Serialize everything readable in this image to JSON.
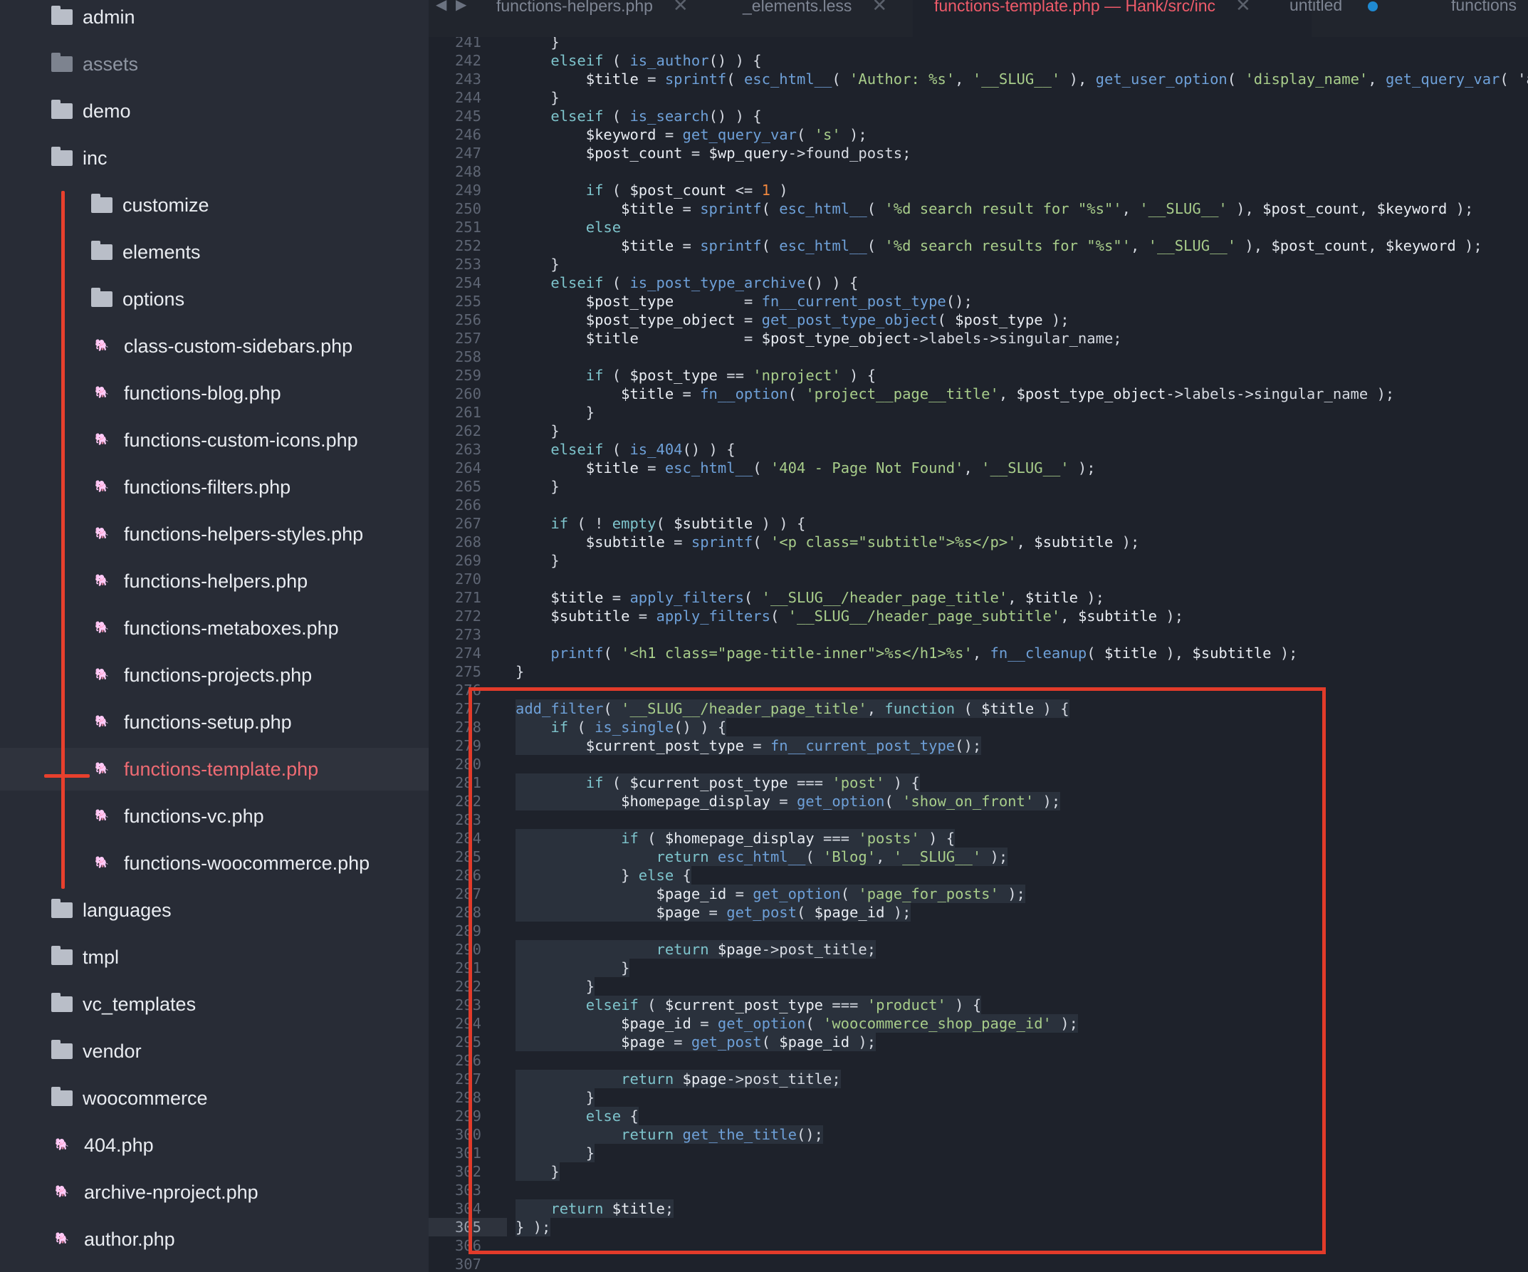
{
  "sidebar": {
    "items": [
      {
        "label": "admin",
        "type": "folder",
        "depth": 0
      },
      {
        "label": "assets",
        "type": "folder",
        "depth": 0,
        "muted": true
      },
      {
        "label": "demo",
        "type": "folder",
        "depth": 0
      },
      {
        "label": "inc",
        "type": "folder-open",
        "depth": 0
      },
      {
        "label": "customize",
        "type": "folder",
        "depth": 1
      },
      {
        "label": "elements",
        "type": "folder",
        "depth": 1
      },
      {
        "label": "options",
        "type": "folder",
        "depth": 1
      },
      {
        "label": "class-custom-sidebars.php",
        "type": "php",
        "depth": 1
      },
      {
        "label": "functions-blog.php",
        "type": "php",
        "depth": 1
      },
      {
        "label": "functions-custom-icons.php",
        "type": "php",
        "depth": 1
      },
      {
        "label": "functions-filters.php",
        "type": "php",
        "depth": 1
      },
      {
        "label": "functions-helpers-styles.php",
        "type": "php",
        "depth": 1
      },
      {
        "label": "functions-helpers.php",
        "type": "php",
        "depth": 1
      },
      {
        "label": "functions-metaboxes.php",
        "type": "php",
        "depth": 1
      },
      {
        "label": "functions-projects.php",
        "type": "php",
        "depth": 1
      },
      {
        "label": "functions-setup.php",
        "type": "php",
        "depth": 1
      },
      {
        "label": "functions-template.php",
        "type": "php",
        "depth": 1,
        "active": true
      },
      {
        "label": "functions-vc.php",
        "type": "php",
        "depth": 1
      },
      {
        "label": "functions-woocommerce.php",
        "type": "php",
        "depth": 1
      },
      {
        "label": "languages",
        "type": "folder",
        "depth": 0
      },
      {
        "label": "tmpl",
        "type": "folder",
        "depth": 0
      },
      {
        "label": "vc_templates",
        "type": "folder",
        "depth": 0
      },
      {
        "label": "vendor",
        "type": "folder",
        "depth": 0
      },
      {
        "label": "woocommerce",
        "type": "folder",
        "depth": 0
      },
      {
        "label": "404.php",
        "type": "php",
        "depth": 0
      },
      {
        "label": "archive-nproject.php",
        "type": "php",
        "depth": 0
      },
      {
        "label": "author.php",
        "type": "php",
        "depth": 0
      }
    ]
  },
  "tabs": [
    {
      "label": "functions-helpers.php",
      "close": "✕"
    },
    {
      "label": "_elements.less",
      "close": "✕"
    },
    {
      "label": "functions-template.php — Hank/src/inc",
      "close": "✕",
      "active": true
    },
    {
      "label": "untitled",
      "modified": true
    },
    {
      "label": "functions"
    }
  ],
  "editor": {
    "current_line": 305,
    "lines": [
      {
        "n": 241,
        "code": "    }"
      },
      {
        "n": 242,
        "code": "    elseif ( is_author() ) {"
      },
      {
        "n": 243,
        "code": "        $title = sprintf( esc_html__( 'Author: %s', '__SLUG__' ), get_user_option( 'display_name', get_query_var( 'auth"
      },
      {
        "n": 244,
        "code": "    }"
      },
      {
        "n": 245,
        "code": "    elseif ( is_search() ) {"
      },
      {
        "n": 246,
        "code": "        $keyword = get_query_var( 's' );"
      },
      {
        "n": 247,
        "code": "        $post_count = $wp_query->found_posts;"
      },
      {
        "n": 248,
        "code": ""
      },
      {
        "n": 249,
        "code": "        if ( $post_count <= 1 )"
      },
      {
        "n": 250,
        "code": "            $title = sprintf( esc_html__( '%d search result for \"%s\"', '__SLUG__' ), $post_count, $keyword );"
      },
      {
        "n": 251,
        "code": "        else"
      },
      {
        "n": 252,
        "code": "            $title = sprintf( esc_html__( '%d search results for \"%s\"', '__SLUG__' ), $post_count, $keyword );"
      },
      {
        "n": 253,
        "code": "    }"
      },
      {
        "n": 254,
        "code": "    elseif ( is_post_type_archive() ) {"
      },
      {
        "n": 255,
        "code": "        $post_type        = fn__current_post_type();"
      },
      {
        "n": 256,
        "code": "        $post_type_object = get_post_type_object( $post_type );"
      },
      {
        "n": 257,
        "code": "        $title            = $post_type_object->labels->singular_name;"
      },
      {
        "n": 258,
        "code": ""
      },
      {
        "n": 259,
        "code": "        if ( $post_type == 'nproject' ) {"
      },
      {
        "n": 260,
        "code": "            $title = fn__option( 'project__page__title', $post_type_object->labels->singular_name );"
      },
      {
        "n": 261,
        "code": "        }"
      },
      {
        "n": 262,
        "code": "    }"
      },
      {
        "n": 263,
        "code": "    elseif ( is_404() ) {"
      },
      {
        "n": 264,
        "code": "        $title = esc_html__( '404 - Page Not Found', '__SLUG__' );"
      },
      {
        "n": 265,
        "code": "    }"
      },
      {
        "n": 266,
        "code": ""
      },
      {
        "n": 267,
        "code": "    if ( ! empty( $subtitle ) ) {"
      },
      {
        "n": 268,
        "code": "        $subtitle = sprintf( '<p class=\"subtitle\">%s</p>', $subtitle );"
      },
      {
        "n": 269,
        "code": "    }"
      },
      {
        "n": 270,
        "code": ""
      },
      {
        "n": 271,
        "code": "    $title = apply_filters( '__SLUG__/header_page_title', $title );"
      },
      {
        "n": 272,
        "code": "    $subtitle = apply_filters( '__SLUG__/header_page_subtitle', $subtitle );"
      },
      {
        "n": 273,
        "code": ""
      },
      {
        "n": 274,
        "code": "    printf( '<h1 class=\"page-title-inner\">%s</h1>%s', fn__cleanup( $title ), $subtitle );"
      },
      {
        "n": 275,
        "code": "}"
      },
      {
        "n": 276,
        "code": ""
      },
      {
        "n": 277,
        "code": "add_filter( '__SLUG__/header_page_title', function ( $title ) {"
      },
      {
        "n": 278,
        "code": "    if ( is_single() ) {"
      },
      {
        "n": 279,
        "code": "        $current_post_type = fn__current_post_type();"
      },
      {
        "n": 280,
        "code": ""
      },
      {
        "n": 281,
        "code": "        if ( $current_post_type === 'post' ) {"
      },
      {
        "n": 282,
        "code": "            $homepage_display = get_option( 'show_on_front' );"
      },
      {
        "n": 283,
        "code": ""
      },
      {
        "n": 284,
        "code": "            if ( $homepage_display === 'posts' ) {"
      },
      {
        "n": 285,
        "code": "                return esc_html__( 'Blog', '__SLUG__' );"
      },
      {
        "n": 286,
        "code": "            } else {"
      },
      {
        "n": 287,
        "code": "                $page_id = get_option( 'page_for_posts' );"
      },
      {
        "n": 288,
        "code": "                $page = get_post( $page_id );"
      },
      {
        "n": 289,
        "code": ""
      },
      {
        "n": 290,
        "code": "                return $page->post_title;"
      },
      {
        "n": 291,
        "code": "            }"
      },
      {
        "n": 292,
        "code": "        }"
      },
      {
        "n": 293,
        "code": "        elseif ( $current_post_type === 'product' ) {"
      },
      {
        "n": 294,
        "code": "            $page_id = get_option( 'woocommerce_shop_page_id' );"
      },
      {
        "n": 295,
        "code": "            $page = get_post( $page_id );"
      },
      {
        "n": 296,
        "code": ""
      },
      {
        "n": 297,
        "code": "            return $page->post_title;"
      },
      {
        "n": 298,
        "code": "        }"
      },
      {
        "n": 299,
        "code": "        else {"
      },
      {
        "n": 300,
        "code": "            return get_the_title();"
      },
      {
        "n": 301,
        "code": "        }"
      },
      {
        "n": 302,
        "code": "    }"
      },
      {
        "n": 303,
        "code": ""
      },
      {
        "n": 304,
        "code": "    return $title;"
      },
      {
        "n": 305,
        "code": "} );"
      },
      {
        "n": 306,
        "code": ""
      },
      {
        "n": 307,
        "code": ""
      }
    ]
  },
  "colors": {
    "annotation": "#e23b2a",
    "active_file": "#ef6b73"
  }
}
